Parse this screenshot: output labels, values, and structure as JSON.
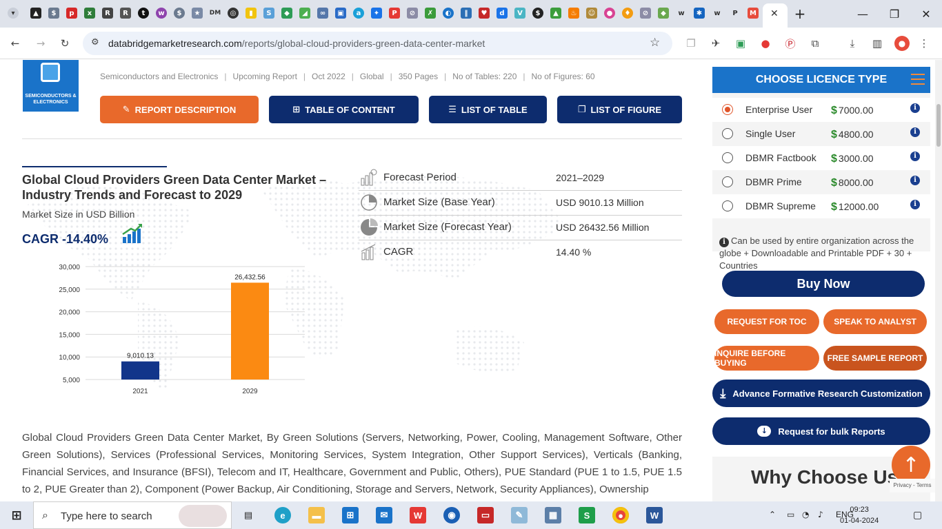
{
  "browser": {
    "url_domain": "databridgemarketresearch.com",
    "url_path": "/reports/global-cloud-providers-green-data-center-market",
    "close_tab": "✕",
    "new_tab": "+",
    "win_min": "—",
    "win_max": "❐",
    "win_close": "✕"
  },
  "report": {
    "category": "Semiconductors and Electronics",
    "status": "Upcoming Report",
    "date": "Oct 2022",
    "region": "Global",
    "pages": "350 Pages",
    "tables": "No of Tables: 220",
    "figures": "No of Figures: 60",
    "logo_text": "SEMICONDUCTORS & ELECTRONICS"
  },
  "nav": {
    "report_description": "REPORT DESCRIPTION",
    "table_of_content": "TABLE OF CONTENT",
    "list_of_table": "LIST OF TABLE",
    "list_of_figure": "LIST OF FIGURE"
  },
  "market": {
    "title": "Global Cloud Providers Green Data Center Market – Industry Trends and Forecast to 2029",
    "size_label": "Market Size in USD Billion",
    "cagr": "CAGR -14.40%",
    "stats": [
      {
        "label": "Forecast Period",
        "value": "2021–2029"
      },
      {
        "label": "Market Size (Base Year)",
        "value": "USD 9010.13 Million"
      },
      {
        "label": "Market Size (Forecast Year)",
        "value": "USD 26432.56 Million"
      },
      {
        "label": "CAGR",
        "value": "14.40 %"
      }
    ],
    "description": "Global Cloud Providers Green Data Center Market, By Green Solutions (Servers, Networking, Power, Cooling, Management Software, Other Green Solutions), Services (Professional Services, Monitoring Services, System Integration, Other Support Services), Verticals (Banking, Financial Services, and Insurance (BFSI), Telecom and IT, Healthcare, Government and Public, Others), PUE Standard (PUE 1 to 1.5, PUE 1.5 to 2, PUE Greater than 2), Component (Power Backup, Air Conditioning, Storage and Servers, Network, Security Appliances), Ownership"
  },
  "chart_data": {
    "type": "bar",
    "categories": [
      "2021",
      "2029"
    ],
    "values": [
      9010.13,
      26432.56
    ],
    "value_labels": [
      "9,010.13",
      "26,432.56"
    ],
    "colors": [
      "#12358a",
      "#fb8a12"
    ],
    "ylim": [
      5000,
      30000
    ],
    "yticks": [
      "5,000",
      "10,000",
      "15,000",
      "20,000",
      "25,000",
      "30,000"
    ],
    "ytick_values": [
      5000,
      10000,
      15000,
      20000,
      25000,
      30000
    ],
    "grid": true
  },
  "licence": {
    "heading": "CHOOSE LICENCE TYPE",
    "options": [
      {
        "name": "Enterprise User",
        "price": "7000.00"
      },
      {
        "name": "Single User",
        "price": "4800.00"
      },
      {
        "name": "DBMR Factbook",
        "price": "3000.00"
      },
      {
        "name": "DBMR Prime",
        "price": "8000.00"
      },
      {
        "name": "DBMR Supreme",
        "price": "12000.00"
      }
    ],
    "currency_symbol": "$",
    "info_glyph": "i",
    "note": "Can be used by entire organization across the globe + Downloadable and Printable PDF + 30 + Countries",
    "buy_now": "Buy Now"
  },
  "actions": {
    "request_toc": "REQUEST FOR TOC",
    "speak_analyst": "SPEAK TO ANALYST",
    "inquire": "INQUIRE BEFORE BUYING",
    "free_sample": "FREE SAMPLE REPORT",
    "advance_customization": "Advance Formative Research Customization",
    "bulk_reports": "Request for bulk Reports",
    "why_choose": "Why Choose Us",
    "recaptcha": "Privacy - Terms"
  },
  "taskbar": {
    "search_placeholder": "Type here to search",
    "lang": "ENG",
    "time": "09:23",
    "date": "01-04-2024"
  }
}
